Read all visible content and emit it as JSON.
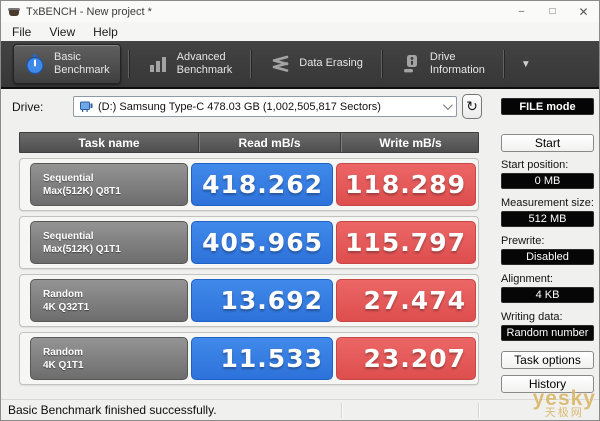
{
  "window": {
    "title": "TxBENCH - New project *",
    "controls": {
      "minimize": "–",
      "maximize": "□",
      "close": "✕"
    }
  },
  "menu": {
    "items": [
      "File",
      "View",
      "Help"
    ]
  },
  "toolbar": {
    "tabs": [
      {
        "line1": "Basic",
        "line2": "Benchmark",
        "icon": "stopwatch"
      },
      {
        "line1": "Advanced",
        "line2": "Benchmark",
        "icon": "bar-chart"
      },
      {
        "line1": "Data Erasing",
        "line2": "",
        "icon": "eraser-zigzag"
      },
      {
        "line1": "Drive",
        "line2": "Information",
        "icon": "drive-info"
      }
    ],
    "overflow_arrow": "▼"
  },
  "drive": {
    "label": "Drive:",
    "selected": "(D:) Samsung Type-C  478.03 GB (1,002,505,817 Sectors)",
    "refresh_glyph": "↻"
  },
  "table": {
    "headers": [
      "Task name",
      "Read mB/s",
      "Write mB/s"
    ],
    "rows": [
      {
        "task_line1": "Sequential",
        "task_line2": "Max(512K) Q8T1",
        "read": "418.262",
        "write": "118.289"
      },
      {
        "task_line1": "Sequential",
        "task_line2": "Max(512K) Q1T1",
        "read": "405.965",
        "write": "115.797"
      },
      {
        "task_line1": "Random",
        "task_line2": "4K Q32T1",
        "read": "13.692",
        "write": "27.474"
      },
      {
        "task_line1": "Random",
        "task_line2": "4K Q1T1",
        "read": "11.533",
        "write": "23.207"
      }
    ]
  },
  "sidebar": {
    "file_mode": "FILE mode",
    "start": "Start",
    "fields": [
      {
        "label": "Start position:",
        "value": "0 MB"
      },
      {
        "label": "Measurement size:",
        "value": "512 MB"
      },
      {
        "label": "Prewrite:",
        "value": "Disabled"
      },
      {
        "label": "Alignment:",
        "value": "4 KB"
      },
      {
        "label": "Writing data:",
        "value": "Random number"
      }
    ],
    "task_options": "Task options",
    "history": "History"
  },
  "statusbar": {
    "message": "Basic Benchmark finished successfully."
  },
  "watermark": {
    "line1": "yesky",
    "line2": "天极网"
  },
  "colors": {
    "read_blue_hi": "#4189ea",
    "read_blue_lo": "#2d72da",
    "write_red_hi": "#ec6666",
    "write_red_lo": "#de4e4e",
    "toolbar_bg": "#3b3b3b",
    "header_bg": "#5a5a5a"
  }
}
